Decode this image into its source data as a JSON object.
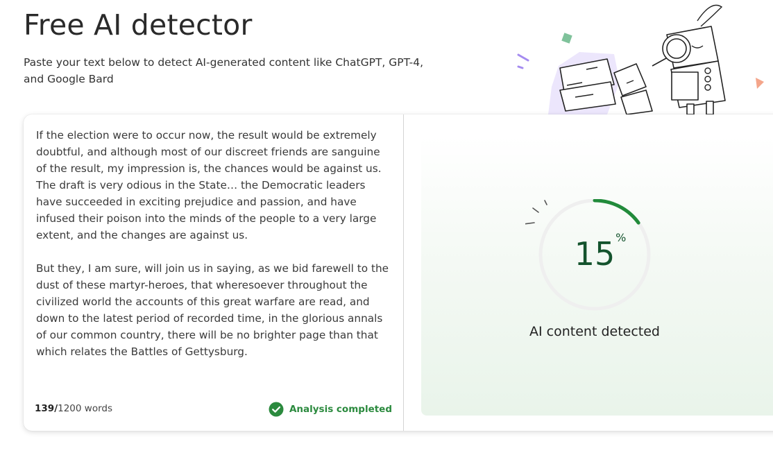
{
  "header": {
    "title": "Free AI detector",
    "subtitle": "Paste your text below to detect AI-generated content like ChatGPT, GPT-4, and Google Bard"
  },
  "editor": {
    "paragraphs": [
      "If the election were to occur now, the result would be extremely doubtful, and although most of our discreet friends are sanguine of the result, my impression is, the chances would be against us. The draft is very odious in the State… the Democratic leaders have succeeded in exciting prejudice and passion, and have infused their poison into the minds of the people to a very large extent, and the changes are against us.",
      "But they, I am sure, will join us in saying, as we bid farewell to the dust of these martyr-heroes, that wheresoever throughout the civilized world the accounts of this great warfare are read, and down to the latest period of recorded time, in the glorious annals of our common country, there will be no brighter page than that which relates the Battles of Gettysburg."
    ],
    "word_count": {
      "current": "139",
      "separator": "/",
      "limit": "1200 words"
    },
    "status": {
      "label": "Analysis completed",
      "icon": "check-circle-icon"
    }
  },
  "result": {
    "score": "15",
    "score_unit": "%",
    "score_fraction": 0.15,
    "label": "AI content detected"
  },
  "colors": {
    "accent_green": "#2b8a3e",
    "score_text": "#14532d",
    "gauge_track": "#efefef",
    "gauge_fill": "#228b3b"
  }
}
